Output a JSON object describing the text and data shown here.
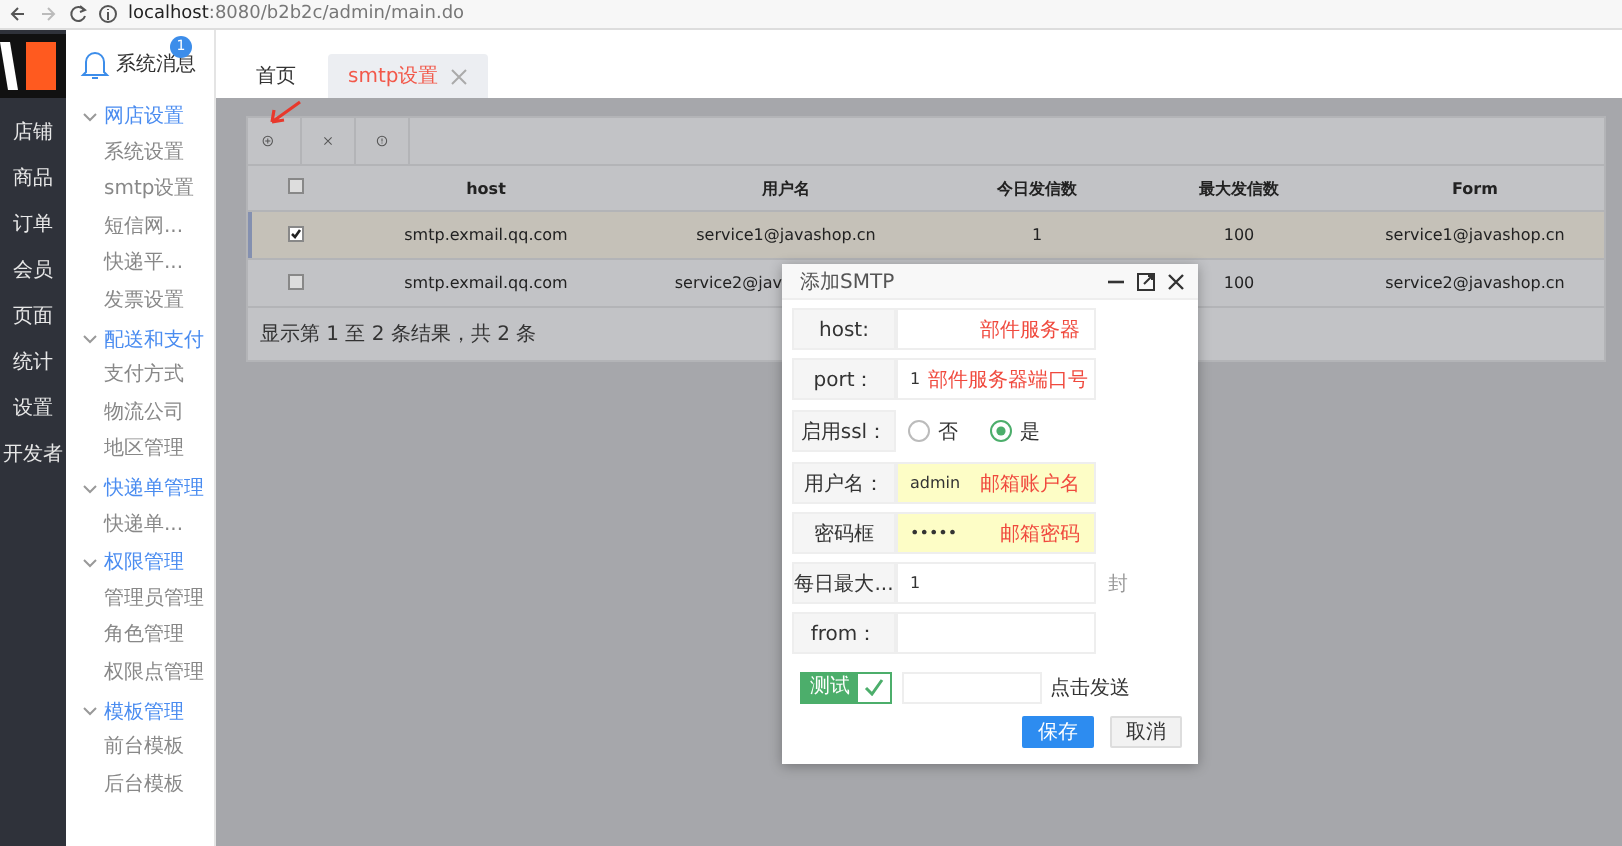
{
  "browser": {
    "host": "localhost",
    "path": ":8080/b2b2c/admin/main.do"
  },
  "rail": {
    "items": [
      "店铺",
      "商品",
      "订单",
      "会员",
      "页面",
      "统计",
      "设置",
      "开发者"
    ]
  },
  "notice": {
    "label": "系统消息",
    "badge": "1"
  },
  "menu": [
    {
      "label": "网店设置",
      "expanded": true,
      "children": [
        "系统设置",
        "smtp设置",
        "短信网...",
        "快递平...",
        "发票设置"
      ]
    },
    {
      "label": "配送和支付",
      "expanded": true,
      "children": [
        "支付方式",
        "物流公司",
        "地区管理"
      ]
    },
    {
      "label": "快递单管理",
      "expanded": true,
      "children": [
        "快递单..."
      ]
    },
    {
      "label": "权限管理",
      "expanded": true,
      "children": [
        "管理员管理",
        "角色管理",
        "权限点管理"
      ]
    },
    {
      "label": "模板管理",
      "expanded": true,
      "children": [
        "前台模板",
        "后台模板"
      ]
    }
  ],
  "tabs": [
    {
      "label": "首页",
      "selected": false,
      "closable": false
    },
    {
      "label": "smtp设置",
      "selected": true,
      "closable": true
    }
  ],
  "table": {
    "columns": [
      "host",
      "用户名",
      "今日发信数",
      "最大发信数",
      "Form"
    ],
    "header_checked": false,
    "rows": [
      {
        "selected": true,
        "checked": true,
        "cells": [
          {
            "text": "smtp.exmail.qq.com"
          },
          {
            "text": "service1@javashop.cn"
          },
          {
            "text": "1"
          },
          {
            "text": "100"
          },
          {
            "text": "service1@javashop.cn"
          }
        ]
      },
      {
        "selected": false,
        "checked": false,
        "cells": [
          {
            "text": "smtp.exmail.qq.com"
          },
          {
            "text": "service2@jav",
            "cut": true
          },
          null,
          {
            "text": "100"
          },
          {
            "text": "service2@javashop.cn"
          }
        ]
      }
    ],
    "footer": "显示第 1 至 2 条结果，共 2 条"
  },
  "dialog": {
    "title": "添加SMTP",
    "fields": [
      {
        "kind": "text",
        "label": "host:",
        "highlighted": false,
        "annotation": "部件服务器"
      },
      {
        "kind": "text",
        "label": "port：",
        "value": "1",
        "highlighted": false,
        "annotation": "部件服务器端口号"
      },
      {
        "kind": "radio",
        "label": "启用ssl：",
        "options": [
          {
            "label": "否",
            "selected": false
          },
          {
            "label": "是",
            "selected": true
          }
        ]
      },
      {
        "kind": "text",
        "label": "用户名：",
        "value": "admin",
        "highlighted": true,
        "annotation": "邮箱账户名"
      },
      {
        "kind": "text",
        "label": "密码框",
        "value": "•••••",
        "highlighted": true,
        "annotation": "邮箱密码"
      },
      {
        "kind": "text",
        "label": "每日最大...",
        "value": "1",
        "highlighted": false,
        "suffix": "封"
      },
      {
        "kind": "text",
        "label": "from：",
        "highlighted": false
      },
      {
        "kind": "test",
        "button": "测试",
        "hint": "点击发送"
      }
    ],
    "buttons": [
      {
        "label": "保存",
        "primary": true
      },
      {
        "label": "取消",
        "primary": false
      }
    ]
  }
}
